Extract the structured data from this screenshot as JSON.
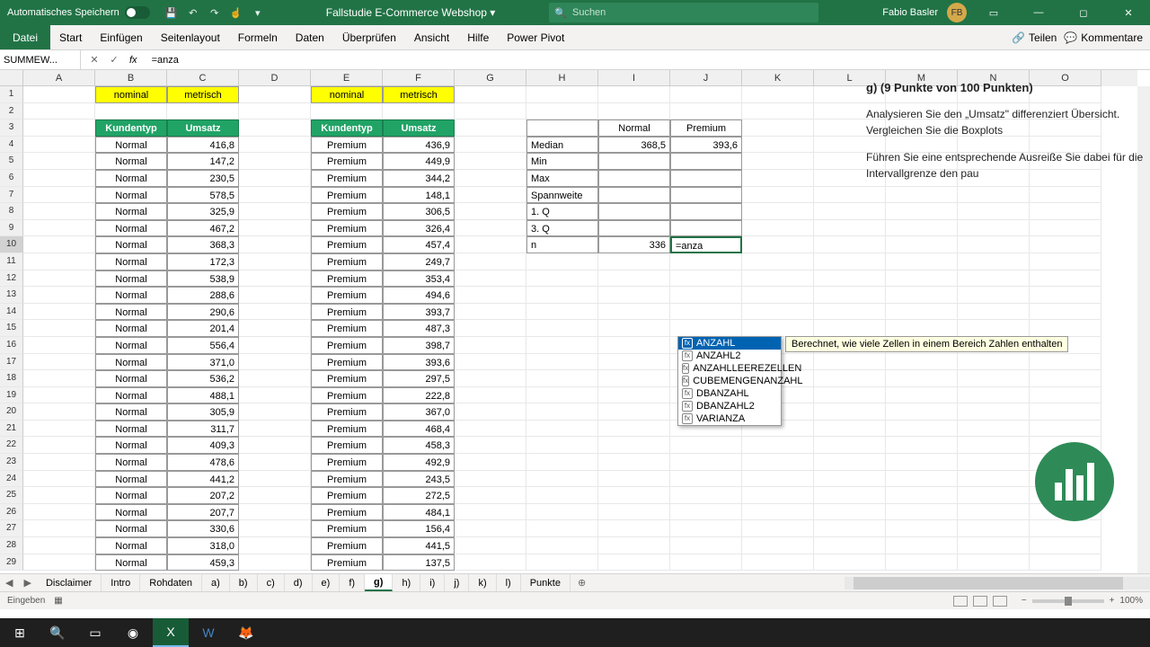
{
  "titlebar": {
    "autosave": "Automatisches Speichern",
    "filename": "Fallstudie E-Commerce Webshop",
    "search_placeholder": "Suchen",
    "user": "Fabio Basler",
    "user_initials": "FB"
  },
  "ribbon": {
    "tabs": [
      "Datei",
      "Start",
      "Einfügen",
      "Seitenlayout",
      "Formeln",
      "Daten",
      "Überprüfen",
      "Ansicht",
      "Hilfe",
      "Power Pivot"
    ],
    "share": "Teilen",
    "comments": "Kommentare"
  },
  "formula_bar": {
    "namebox": "SUMMEW...",
    "formula": "=anza"
  },
  "columns": [
    "A",
    "B",
    "C",
    "D",
    "E",
    "F",
    "G",
    "H",
    "I",
    "J",
    "K",
    "L",
    "M",
    "N",
    "O"
  ],
  "row_numbers": [
    1,
    2,
    3,
    4,
    5,
    6,
    7,
    8,
    9,
    10,
    11,
    12,
    13,
    14,
    15,
    16,
    17,
    18,
    19,
    20,
    21,
    22,
    23,
    24,
    25,
    26,
    27,
    28,
    29
  ],
  "data": {
    "b1": "nominal",
    "c1": "metrisch",
    "e1": "nominal",
    "f1": "metrisch",
    "b3": "Kundentyp",
    "c3": "Umsatz",
    "e3": "Kundentyp",
    "f3": "Umsatz",
    "left": [
      {
        "t": "Normal",
        "v": "416,8"
      },
      {
        "t": "Normal",
        "v": "147,2"
      },
      {
        "t": "Normal",
        "v": "230,5"
      },
      {
        "t": "Normal",
        "v": "578,5"
      },
      {
        "t": "Normal",
        "v": "325,9"
      },
      {
        "t": "Normal",
        "v": "467,2"
      },
      {
        "t": "Normal",
        "v": "368,3"
      },
      {
        "t": "Normal",
        "v": "172,3"
      },
      {
        "t": "Normal",
        "v": "538,9"
      },
      {
        "t": "Normal",
        "v": "288,6"
      },
      {
        "t": "Normal",
        "v": "290,6"
      },
      {
        "t": "Normal",
        "v": "201,4"
      },
      {
        "t": "Normal",
        "v": "556,4"
      },
      {
        "t": "Normal",
        "v": "371,0"
      },
      {
        "t": "Normal",
        "v": "536,2"
      },
      {
        "t": "Normal",
        "v": "488,1"
      },
      {
        "t": "Normal",
        "v": "305,9"
      },
      {
        "t": "Normal",
        "v": "311,7"
      },
      {
        "t": "Normal",
        "v": "409,3"
      },
      {
        "t": "Normal",
        "v": "478,6"
      },
      {
        "t": "Normal",
        "v": "441,2"
      },
      {
        "t": "Normal",
        "v": "207,2"
      },
      {
        "t": "Normal",
        "v": "207,7"
      },
      {
        "t": "Normal",
        "v": "330,6"
      },
      {
        "t": "Normal",
        "v": "318,0"
      },
      {
        "t": "Normal",
        "v": "459,3"
      }
    ],
    "right": [
      {
        "t": "Premium",
        "v": "436,9"
      },
      {
        "t": "Premium",
        "v": "449,9"
      },
      {
        "t": "Premium",
        "v": "344,2"
      },
      {
        "t": "Premium",
        "v": "148,1"
      },
      {
        "t": "Premium",
        "v": "306,5"
      },
      {
        "t": "Premium",
        "v": "326,4"
      },
      {
        "t": "Premium",
        "v": "457,4"
      },
      {
        "t": "Premium",
        "v": "249,7"
      },
      {
        "t": "Premium",
        "v": "353,4"
      },
      {
        "t": "Premium",
        "v": "494,6"
      },
      {
        "t": "Premium",
        "v": "393,7"
      },
      {
        "t": "Premium",
        "v": "487,3"
      },
      {
        "t": "Premium",
        "v": "398,7"
      },
      {
        "t": "Premium",
        "v": "393,6"
      },
      {
        "t": "Premium",
        "v": "297,5"
      },
      {
        "t": "Premium",
        "v": "222,8"
      },
      {
        "t": "Premium",
        "v": "367,0"
      },
      {
        "t": "Premium",
        "v": "468,4"
      },
      {
        "t": "Premium",
        "v": "458,3"
      },
      {
        "t": "Premium",
        "v": "492,9"
      },
      {
        "t": "Premium",
        "v": "243,5"
      },
      {
        "t": "Premium",
        "v": "272,5"
      },
      {
        "t": "Premium",
        "v": "484,1"
      },
      {
        "t": "Premium",
        "v": "156,4"
      },
      {
        "t": "Premium",
        "v": "441,5"
      },
      {
        "t": "Premium",
        "v": "137,5"
      }
    ],
    "stats": {
      "i3": "Normal",
      "j3": "Premium",
      "labels": [
        "Median",
        "Min",
        "Max",
        "Spannweite",
        "1. Q",
        "3. Q",
        "n"
      ],
      "i4": "368,5",
      "j4": "393,6",
      "i10": "336",
      "j10": "=anza"
    }
  },
  "autocomplete": {
    "items": [
      "ANZAHL",
      "ANZAHL2",
      "ANZAHLLEEREZELLEN",
      "CUBEMENGENANZAHL",
      "DBANZAHL",
      "DBANZAHL2",
      "VARIANZA"
    ],
    "selected": 0,
    "tooltip": "Berechnet, wie viele Zellen in einem Bereich Zahlen enthalten"
  },
  "task": {
    "heading": "g) (9 Punkte von 100 Punkten)",
    "p1": "Analysieren Sie den „Umsatz\" differenziert Übersicht. Vergleichen Sie die Boxplots",
    "p2": "Führen Sie eine entsprechende Ausreiße Sie dabei für die Intervallgrenze den pau"
  },
  "sheet_tabs": [
    "Disclaimer",
    "Intro",
    "Rohdaten",
    "a)",
    "b)",
    "c)",
    "d)",
    "e)",
    "f)",
    "g)",
    "h)",
    "i)",
    "j)",
    "k)",
    "l)",
    "Punkte"
  ],
  "active_sheet": "g)",
  "statusbar": {
    "mode": "Eingeben",
    "zoom": "100%"
  }
}
